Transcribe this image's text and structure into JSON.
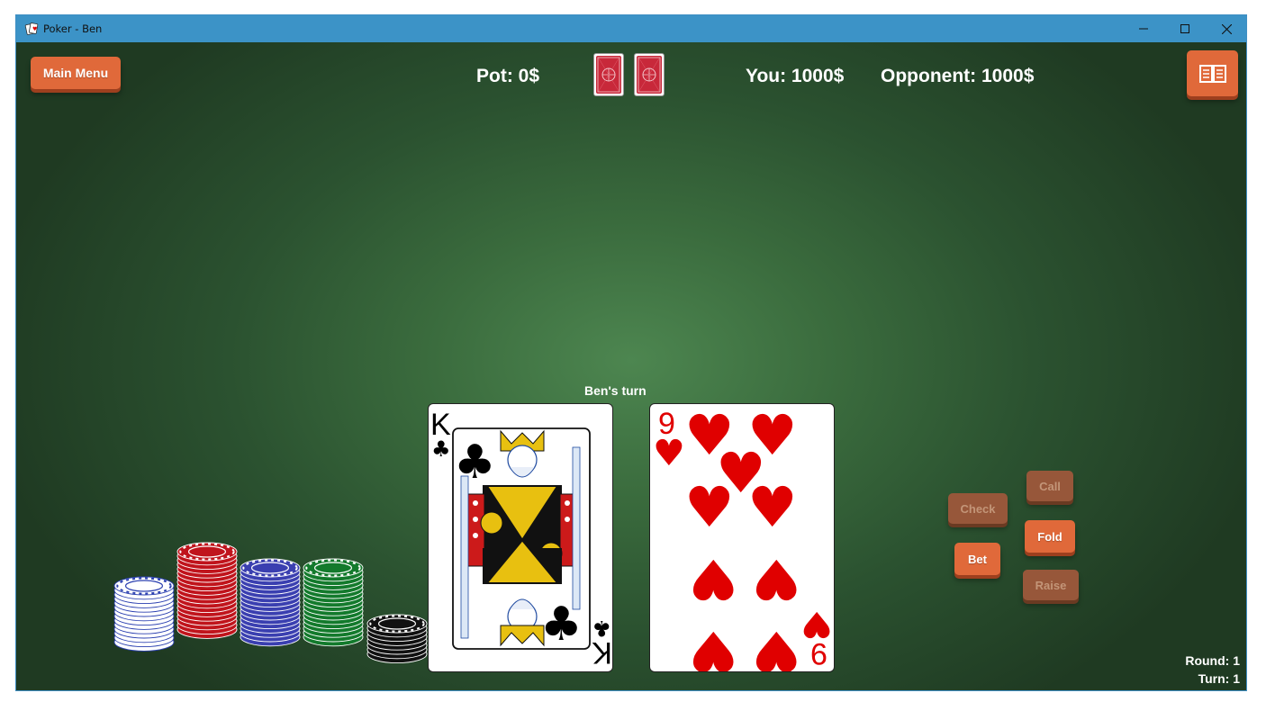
{
  "window": {
    "title": "Poker - Ben",
    "controls": [
      "minimize",
      "maximize",
      "close"
    ]
  },
  "header": {
    "main_menu_label": "Main Menu",
    "pot_text": "Pot: 0$",
    "you_text": "You: 1000$",
    "opponent_text": "Opponent: 1000$",
    "rules_icon": "open-book-icon",
    "deck_backs": 2
  },
  "turn_label": "Ben's turn",
  "hand": [
    {
      "rank": "K",
      "suit": "clubs",
      "suit_symbol": "♣",
      "color": "#000000"
    },
    {
      "rank": "9",
      "suit": "hearts",
      "suit_symbol": "♥",
      "color": "#e00000"
    }
  ],
  "actions": {
    "check": {
      "label": "Check",
      "enabled": false
    },
    "call": {
      "label": "Call",
      "enabled": false
    },
    "fold": {
      "label": "Fold",
      "enabled": true
    },
    "bet": {
      "label": "Bet",
      "enabled": true
    },
    "raise": {
      "label": "Raise",
      "enabled": false
    }
  },
  "chips": [
    {
      "color": "white",
      "hex": "#ffffff",
      "stroke": "#2a3fb0"
    },
    {
      "color": "red",
      "hex": "#c0141c",
      "stroke": "#ffffff"
    },
    {
      "color": "blue",
      "hex": "#3a3fb0",
      "stroke": "#ffffff"
    },
    {
      "color": "green",
      "hex": "#137a2c",
      "stroke": "#ffffff"
    },
    {
      "color": "black",
      "hex": "#111111",
      "stroke": "#ffffff"
    }
  ],
  "status": {
    "round_text": "Round: 1",
    "turn_text": "Turn: 1"
  },
  "colors": {
    "titlebar": "#3c93c7",
    "accent": "#e0693a",
    "accent_disabled": "#97573a",
    "felt": "#3a6b3d"
  }
}
